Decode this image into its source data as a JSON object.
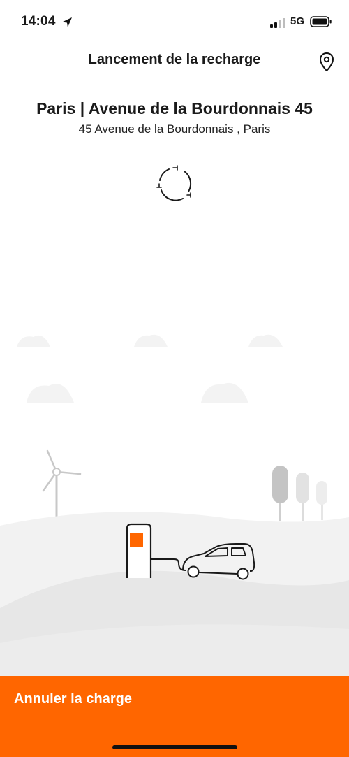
{
  "status_bar": {
    "time": "14:04",
    "network": "5G",
    "icons": [
      "location-arrow-icon",
      "signal-icon",
      "battery-icon"
    ]
  },
  "header": {
    "title": "Lancement de la recharge",
    "map_icon": "map-pin-icon"
  },
  "station": {
    "name": "Paris | Avenue de la Bourdonnais 45",
    "address": "45 Avenue de la Bourdonnais , Paris"
  },
  "loader": {
    "icon": "charging-plug-spinner-icon"
  },
  "illustration": {
    "icon": "ev-charging-landscape-illustration"
  },
  "action": {
    "cancel_label": "Annuler la charge"
  },
  "colors": {
    "accent": "#ff6600",
    "text": "#1a1a1a",
    "hill_light": "#f2f2f2",
    "hill_mid": "#e6e6e6"
  }
}
